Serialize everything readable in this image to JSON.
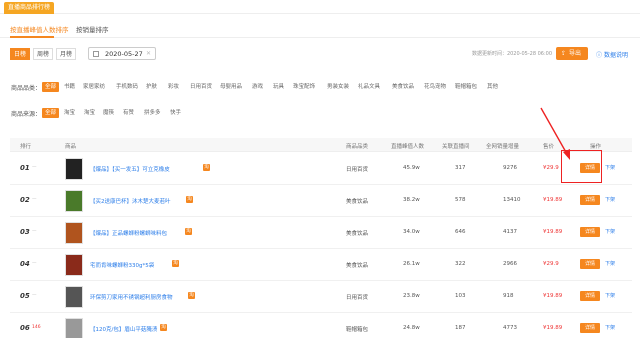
{
  "window": {
    "title": "直播商品排行榜"
  },
  "tabs": [
    {
      "label": "按直播峰值人数排序"
    },
    {
      "label": "按销量排序"
    }
  ],
  "periods": [
    "日榜",
    "周榜",
    "月榜"
  ],
  "date": {
    "value": "2020-05-27"
  },
  "update_time": "数据更新时间：2020-05-28 06:00",
  "toolbar": {
    "export_label": "导出",
    "help_label": "数据说明"
  },
  "filters": {
    "category": {
      "label": "商品品类：",
      "options": [
        "全部",
        "书籍",
        "家居家纺",
        "手机数码",
        "护肤",
        "彩妆",
        "日用百货",
        "母婴用品",
        "游戏",
        "玩具",
        "珠宝配饰",
        "男装女装",
        "礼品文具",
        "美食饮品",
        "花鸟宠物",
        "鞋帽箱包",
        "其他"
      ]
    },
    "source": {
      "label": "商品来源：",
      "options": [
        "全部",
        "淘宝",
        "淘宝",
        "魔筷",
        "有赞",
        "拼多多",
        "快手"
      ]
    }
  },
  "table": {
    "headers": [
      "排行",
      "商品",
      "商品品类",
      "直播峰值人数",
      "关联直播间",
      "全网销量增量",
      "售价",
      "操作"
    ],
    "detail_label": "详情",
    "more_label": "下架",
    "rows": [
      {
        "rank": "01",
        "change": "—",
        "name": "【爆品】【买一发五】可立克橡皮",
        "category": "日用百货",
        "peak": "45.9w",
        "rooms": "317",
        "sales": "9276",
        "price": "¥29.9"
      },
      {
        "rank": "02",
        "change": "—",
        "name": "【买2送康巴杯】沐木楚大麦若叶",
        "category": "美食饮品",
        "peak": "38.2w",
        "rooms": "578",
        "sales": "13410",
        "price": "¥19.89"
      },
      {
        "rank": "03",
        "change": "—",
        "name": "【爆品】正品螺蛳粉螺蛳味料包",
        "category": "美食饮品",
        "peak": "34.0w",
        "rooms": "646",
        "sales": "4137",
        "price": "¥19.89"
      },
      {
        "rank": "04",
        "change": "—",
        "name": "宅而肯味螺蛳粉330g*5袋",
        "category": "美食饮品",
        "peak": "26.1w",
        "rooms": "322",
        "sales": "2966",
        "price": "¥29.9"
      },
      {
        "rank": "05",
        "change": "—",
        "name": "环保剪刀家用不锈钢超利厨房食物",
        "category": "日用百货",
        "peak": "23.8w",
        "rooms": "103",
        "sales": "918",
        "price": "¥19.89"
      },
      {
        "rank": "06",
        "change": "146",
        "name": "【120克/包】眉山平菇腌渍",
        "category": "鞋帽箱包",
        "peak": "24.8w",
        "rooms": "187",
        "sales": "4773",
        "price": "¥19.89"
      }
    ]
  }
}
